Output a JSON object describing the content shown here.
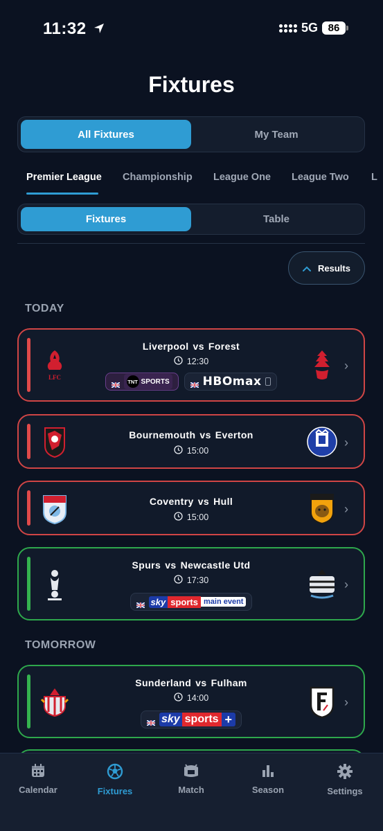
{
  "status_bar": {
    "time": "11:32",
    "network": "5G",
    "battery": "86"
  },
  "title": "Fixtures",
  "view_toggle": {
    "options": [
      "All Fixtures",
      "My Team"
    ],
    "selected": "All Fixtures"
  },
  "league_tabs": {
    "items": [
      "Premier League",
      "Championship",
      "League One",
      "League Two",
      "L"
    ],
    "selected": "Premier League"
  },
  "sub_toggle": {
    "options": [
      "Fixtures",
      "Table"
    ],
    "selected": "Fixtures"
  },
  "results_button": {
    "label": "Results",
    "icon": "chevron-up-icon"
  },
  "sections": [
    {
      "label": "TODAY",
      "matches": [
        {
          "home": "Liverpool",
          "vs": "vs",
          "away": "Forest",
          "time": "12:30",
          "status_color": "#d04545",
          "broadcasters": [
            "TNT SPORTS",
            "HBOmax"
          ]
        },
        {
          "home": "Bournemouth",
          "vs": "vs",
          "away": "Everton",
          "time": "15:00",
          "status_color": "#d04545",
          "broadcasters": []
        },
        {
          "home": "Coventry",
          "vs": "vs",
          "away": "Hull",
          "time": "15:00",
          "status_color": "#d04545",
          "broadcasters": []
        },
        {
          "home": "Spurs",
          "vs": "vs",
          "away": "Newcastle Utd",
          "time": "17:30",
          "status_color": "#2ea84c",
          "broadcasters": [
            "sky sports main event"
          ]
        }
      ]
    },
    {
      "label": "TOMORROW",
      "matches": [
        {
          "home": "Sunderland",
          "vs": "vs",
          "away": "Fulham",
          "time": "14:00",
          "status_color": "#2ea84c",
          "broadcasters": [
            "sky sports +"
          ]
        }
      ]
    }
  ],
  "broadcaster_text": {
    "tnt": "SPORTS",
    "tnt_mark": "TNT",
    "hbo": "HBOmax",
    "sky": "sky",
    "sports": "sports",
    "main_event": "main event",
    "plus": "+"
  },
  "crest_text": {
    "lfc": "LFC"
  },
  "tab_bar": {
    "items": [
      {
        "label": "Calendar",
        "icon": "calendar-icon"
      },
      {
        "label": "Fixtures",
        "icon": "football-icon"
      },
      {
        "label": "Match",
        "icon": "stadium-icon"
      },
      {
        "label": "Season",
        "icon": "bar-chart-icon"
      },
      {
        "label": "Settings",
        "icon": "gear-icon"
      }
    ],
    "selected": "Fixtures"
  },
  "colors": {
    "accent": "#2f9cd3",
    "live_red": "#d04545",
    "live_green": "#2ea84c",
    "background": "#0b1221"
  }
}
